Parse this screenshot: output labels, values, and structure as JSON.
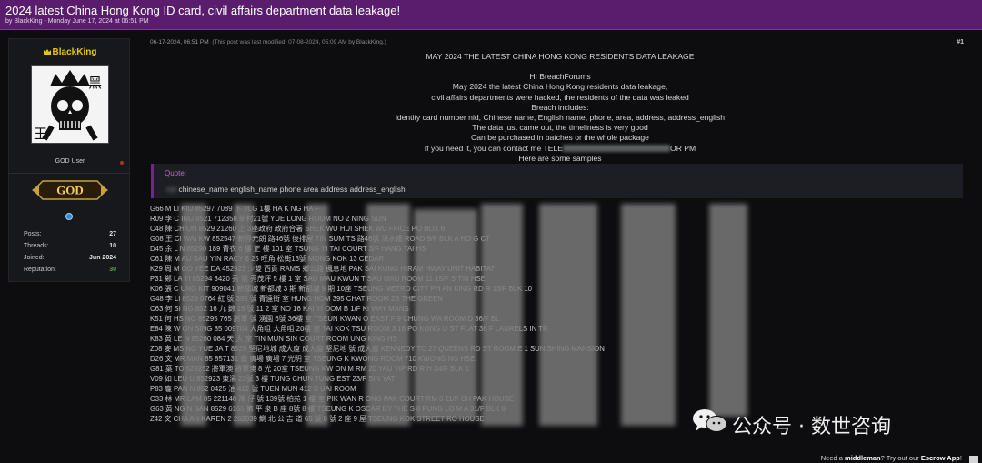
{
  "thread": {
    "title": "2024 latest China Hong Kong ID card, civil affairs department data leakage!",
    "byline": "by BlackKing - Monday June 17, 2024 at 06:51 PM"
  },
  "user": {
    "name": "BlackKing",
    "role": "GOD User",
    "badge": "GOD",
    "avatar_chars": [
      "黑",
      "王"
    ],
    "stats": [
      {
        "label": "Posts:",
        "value": "27"
      },
      {
        "label": "Threads:",
        "value": "10"
      },
      {
        "label": "Joined:",
        "value": "Jun 2024"
      },
      {
        "label": "Reputation:",
        "value": "30"
      }
    ]
  },
  "post": {
    "date": "06-17-2024, 06:51 PM",
    "modified": "(This post was last modified: 07-08-2024, 05:09 AM by BlackKing.)",
    "number": "#1",
    "lines": [
      "MAY 2024 THE LATEST CHINA HONG KONG RESIDENTS DATA LEAKAGE",
      "HI BreachForums",
      "May 2024 the latest China Hong Kong residents data leakage,",
      "civil affairs departments were hacked, the residents of the data was leaked",
      "Breach includes:",
      "identity card number nid, Chinese name, English name, phone, area, address, address_english",
      "The data just came out, the timeliness is very good",
      "Can be purchased in batches or the whole package",
      "If you need it, you can contact me TELE",
      "OR PM",
      "Here are some samples"
    ],
    "quote_label": "Quote:",
    "quote_text": "chinese_name english_name phone area address address_english",
    "quote_prefix": "nid"
  },
  "sample_rows": [
    "G66        M          LI      KIU 85297      7089 下            VLG 1樓      HA K   NG HA      F",
    "R09               李 C      ING 8521     712358      新村21號 YUE LONG           ROOM NO 2            NING SUN",
    "C48               陳 CH      ON 8529      21260 上        3座政府  政府合署 SHEK WU HUI SHEK WU           FFICE PO BOX 6",
    "G08               王 CI      WAI KW      852547     新界元朗 路46號 後排屋 TIN SUM TS   路46號 洪水橋 ROAD       9/F BLK A HO       G CT",
    "D45               余 L      N 85290      189 青衣       6 樓 正 樓 101 室  TSUNG YI       TAI COURT            3/F HANG TAI HS",
    "C61               陳 M      AU SAU YIN     RACY 8      25 旺角       松街13號 MONG KOK 13 CEDAR",
    "K29               周 M      OO YEE DA      452923      少雙 西貢    RAMS 鄉公路       楓息地 PAK         SAI KUNG HIRAM      HWAY UNIT         HABITAT",
    "P31               鄭 LA      YI 85294      3420 秀      號 秀茂坪 5 樓 1 室 SAU MAU   KWUN T    SAU MAU       ROOM 11 15/F S     TIN HSE",
    "K06               張 C      UNG KIT      909041     新都城  新都城 3 期  新都城 9 期 10座 TSEUNG     METRO CITY PH      AN KING RD R     13/F BLK 10",
    "G48               李 LI      8529      0764 紅      號 395 號     青遠街 室 HUNG HOM 395 CHAT       ROOM 2B THE       GREEN",
    "C63               何 SI      NG 852      16 九 錦 16  號      11 2 室 NO 16 KAI YI        OOM B 1/F KI     WAY MANS",
    "K51               何 HS      NG 85295      765 將軍       號 湧園 6號 36樓 室 TSEUN KWAN O EAST F      9 CHUNG WA   ROOM D 36/F BL",
    "E84               陳 W      ON SING 85      009704 大角咀     大角咀 20樓 室 TAI KOK TSU     ROOM 3 18  PO KONG      U ST FLAT 38     F LAURELS IN    TR",
    "K83               黃 LE      N 85260      084 天      大 室 TIN MUN SIN  COURT ROOM         UNG KING HS",
    "Z08               麥 MS      NG YUE JA    T 8529     堅尼地城 成大廈  成大廈 堅尼地 號  成大廈 KENNEDY TO      27 QUEENS RD     ST ROOM E 1       SUN SHING MANSION",
    "D26               文 MR      MAN 85      857131 南       廣場 廣場 7 光明 室 TSEUNG K         KWONG   ROOM 710 KWONG       NG HSE",
    "G81               葉 TO      529252     將軍澳    將軍澳 8 光 20室 TSEUNG KW        ON M      RM 20  YAU YIP RD R    H 34/F BLK 1",
    "V09               如 LEU      U 852923     東涌      23號 3 樓 TUNG CHUN      TUNG EST          23/F SIN YAT",
    "P83               龐 PAN      N 852      0425 油     412 號 TUEN MUN 412 S      UAI ROOM",
    "C33               林 MR      LAM 85     221148 灣 仔  號 139號 柏苑    1 樓  室  PIK WAN R        ONG PAK COURT RM 6 11/F CH      PAK HOUSE",
    "G63               黃 NG      N SAN 8529     6166 第    平 泉   B 座 8號 8 樓 TSEUNG K        OSCAR BY THE S     8 PUNG LO      M  A 31/F BLK 8",
    "Z42               文 CHA      AN KAREN 2      262039 鰂    北 公 吉 道    65 號 8 號 2 座 9  屋 TSEUNG KOK          STREET RO      HOUSE"
  ],
  "watermark": {
    "text": "公众号 · 数世咨询"
  },
  "footer": {
    "lead": "Need a ",
    "link": "middleman",
    "mid": "? Try out our ",
    "app": "Escrow App",
    "end": "!"
  },
  "colors": {
    "title_bar": "#5a1d6e",
    "username": "#e8c20a",
    "quote_accent": "#6a2a88",
    "reputation": "#5fa04a"
  }
}
